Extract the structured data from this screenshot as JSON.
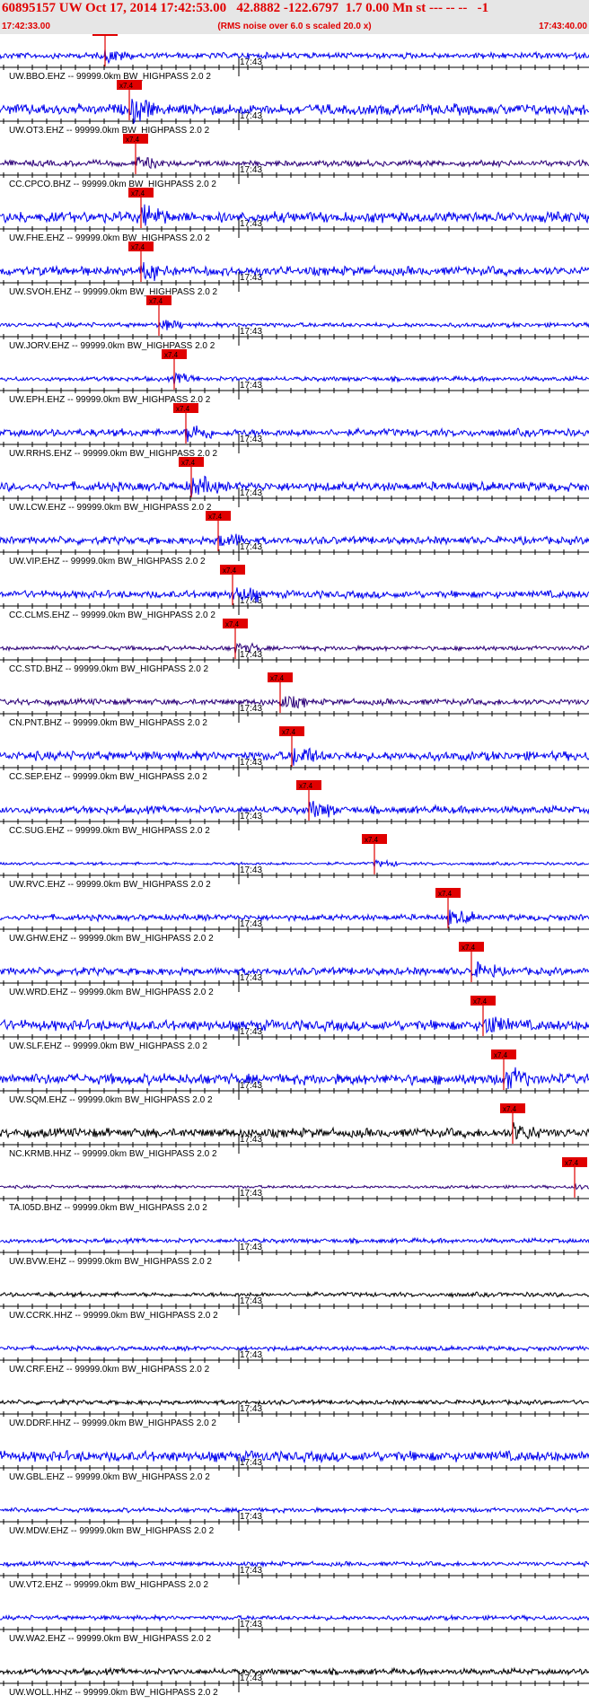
{
  "header": {
    "title": "60895157 UW Oct 17, 2014 17:42:53.00   42.8882 -122.6797  1.7 0.00 Mn st --- -- --   -1",
    "start_time": "17:42:33.00",
    "note": "(RMS noise over 6.0 s scaled 20.0 x)",
    "end_time": "17:43:40.00"
  },
  "colors": {
    "header_bg": "#e6e6e6",
    "header_text": "#e00000",
    "pick_marker": "#e00000",
    "trace_blue": "#0000ee",
    "trace_purple": "#2c0078",
    "trace_black": "#000000"
  },
  "chart_data": {
    "type": "line",
    "title": "60895157 UW Oct 17, 2014 17:42:53.00   42.8882 -122.6797  1.7 0.00 Mn st --- -- --   -1",
    "x_range": [
      "17:42:33.00",
      "17:43:40.00"
    ],
    "minute_tick_label": "17:43",
    "pick_label": "x7.4",
    "grid": false,
    "traces": [
      {
        "label": "UW.BBO.EHZ -- 99999.0km BW_HIGHPASS  2.0  2",
        "color": "#0000ee",
        "amplitude": 4,
        "pick_fraction": 0.178,
        "has_pick": true
      },
      {
        "label": "UW.OT3.EHZ -- 99999.0km BW_HIGHPASS  2.0  2",
        "color": "#0000ee",
        "amplitude": 7,
        "pick_fraction": 0.22,
        "has_pick": true
      },
      {
        "label": "CC.CPCO.BHZ -- 99999.0km BW_HIGHPASS  2.0  2",
        "color": "#2c0078",
        "amplitude": 4,
        "pick_fraction": 0.23,
        "has_pick": true
      },
      {
        "label": "UW.FHE.EHZ -- 99999.0km BW_HIGHPASS  2.0  2",
        "color": "#0000ee",
        "amplitude": 7,
        "pick_fraction": 0.24,
        "has_pick": true
      },
      {
        "label": "UW.SVOH.EHZ -- 99999.0km BW_HIGHPASS  2.0  2",
        "color": "#0000ee",
        "amplitude": 6,
        "pick_fraction": 0.24,
        "has_pick": true
      },
      {
        "label": "UW.JORV.EHZ -- 99999.0km BW_HIGHPASS  2.0  2",
        "color": "#0000ee",
        "amplitude": 3,
        "pick_fraction": 0.27,
        "has_pick": true
      },
      {
        "label": "UW.EPH.EHZ -- 99999.0km BW_HIGHPASS  2.0  2",
        "color": "#0000ee",
        "amplitude": 3,
        "pick_fraction": 0.295,
        "has_pick": true
      },
      {
        "label": "UW.RRHS.EHZ -- 99999.0km BW_HIGHPASS  2.0  2",
        "color": "#0000ee",
        "amplitude": 5,
        "pick_fraction": 0.315,
        "has_pick": true
      },
      {
        "label": "UW.LCW.EHZ -- 99999.0km BW_HIGHPASS  2.0  2",
        "color": "#0000ee",
        "amplitude": 6,
        "pick_fraction": 0.325,
        "has_pick": true
      },
      {
        "label": "UW.VIP.EHZ -- 99999.0km BW_HIGHPASS  2.0  2",
        "color": "#0000ee",
        "amplitude": 5,
        "pick_fraction": 0.37,
        "has_pick": true
      },
      {
        "label": "CC.CLMS.EHZ -- 99999.0km BW_HIGHPASS  2.0  2",
        "color": "#0000ee",
        "amplitude": 5,
        "pick_fraction": 0.395,
        "has_pick": true
      },
      {
        "label": "CC.STD.BHZ -- 99999.0km BW_HIGHPASS  2.0  2",
        "color": "#2c0078",
        "amplitude": 3,
        "pick_fraction": 0.4,
        "has_pick": true
      },
      {
        "label": "CN.PNT.BHZ -- 99999.0km BW_HIGHPASS  2.0  2",
        "color": "#2c0078",
        "amplitude": 4,
        "pick_fraction": 0.475,
        "has_pick": true
      },
      {
        "label": "CC.SEP.EHZ -- 99999.0km BW_HIGHPASS  2.0  2",
        "color": "#0000ee",
        "amplitude": 6,
        "pick_fraction": 0.495,
        "has_pick": true
      },
      {
        "label": "CC.SUG.EHZ -- 99999.0km BW_HIGHPASS  2.0  2",
        "color": "#0000ee",
        "amplitude": 5,
        "pick_fraction": 0.525,
        "has_pick": true
      },
      {
        "label": "UW.RVC.EHZ -- 99999.0km BW_HIGHPASS  2.0  2",
        "color": "#0000ee",
        "amplitude": 2,
        "pick_fraction": 0.635,
        "has_pick": true
      },
      {
        "label": "UW.GHW.EHZ -- 99999.0km BW_HIGHPASS  2.0  2",
        "color": "#0000ee",
        "amplitude": 4,
        "pick_fraction": 0.76,
        "has_pick": true
      },
      {
        "label": "UW.WRD.EHZ -- 99999.0km BW_HIGHPASS  2.0  2",
        "color": "#0000ee",
        "amplitude": 5,
        "pick_fraction": 0.8,
        "has_pick": true
      },
      {
        "label": "UW.SLF.EHZ -- 99999.0km BW_HIGHPASS  2.0  2",
        "color": "#0000ee",
        "amplitude": 7,
        "pick_fraction": 0.82,
        "has_pick": true
      },
      {
        "label": "UW.SQM.EHZ -- 99999.0km BW_HIGHPASS  2.0  2",
        "color": "#0000ee",
        "amplitude": 7,
        "pick_fraction": 0.855,
        "has_pick": true
      },
      {
        "label": "NC.KRMB.HHZ -- 99999.0km BW_HIGHPASS  2.0  2",
        "color": "#000000",
        "amplitude": 6,
        "pick_fraction": 0.87,
        "has_pick": true
      },
      {
        "label": "TA.I05D.BHZ -- 99999.0km BW_HIGHPASS  2.0  2",
        "color": "#2c0078",
        "amplitude": 2,
        "pick_fraction": 0.975,
        "has_pick": true
      },
      {
        "label": "UW.BVW.EHZ -- 99999.0km BW_HIGHPASS  2.0  2",
        "color": "#0000ee",
        "amplitude": 3,
        "pick_fraction": 0,
        "has_pick": false
      },
      {
        "label": "UW.CCRK.HHZ -- 99999.0km BW_HIGHPASS  2.0  2",
        "color": "#000000",
        "amplitude": 3,
        "pick_fraction": 0,
        "has_pick": false
      },
      {
        "label": "UW.CRF.EHZ -- 99999.0km BW_HIGHPASS  2.0  2",
        "color": "#0000ee",
        "amplitude": 3,
        "pick_fraction": 0,
        "has_pick": false
      },
      {
        "label": "UW.DDRF.HHZ -- 99999.0km BW_HIGHPASS  2.0  2",
        "color": "#000000",
        "amplitude": 3,
        "pick_fraction": 0,
        "has_pick": false
      },
      {
        "label": "UW.GBL.EHZ -- 99999.0km BW_HIGHPASS  2.0  2",
        "color": "#0000ee",
        "amplitude": 7,
        "pick_fraction": 0,
        "has_pick": false
      },
      {
        "label": "UW.MDW.EHZ -- 99999.0km BW_HIGHPASS  2.0  2",
        "color": "#0000ee",
        "amplitude": 3,
        "pick_fraction": 0,
        "has_pick": false
      },
      {
        "label": "UW.VT2.EHZ -- 99999.0km BW_HIGHPASS  2.0  2",
        "color": "#0000ee",
        "amplitude": 3,
        "pick_fraction": 0,
        "has_pick": false
      },
      {
        "label": "UW.WA2.EHZ -- 99999.0km BW_HIGHPASS  2.0  2",
        "color": "#0000ee",
        "amplitude": 3,
        "pick_fraction": 0,
        "has_pick": false
      },
      {
        "label": "UW.WOLL.HHZ -- 99999.0km BW_HIGHPASS  2.0  2",
        "color": "#000000",
        "amplitude": 4,
        "pick_fraction": 0,
        "has_pick": false
      }
    ]
  }
}
